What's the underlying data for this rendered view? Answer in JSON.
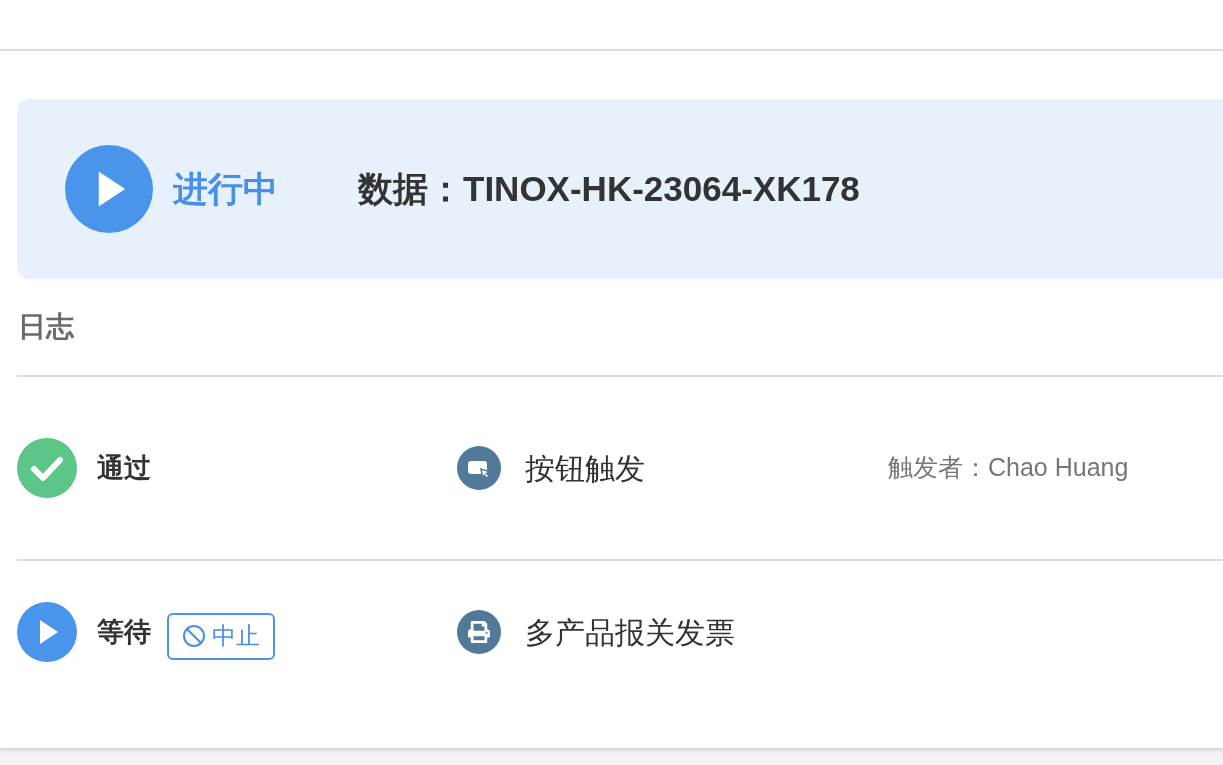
{
  "status_banner": {
    "kind": "running",
    "status": "进行中",
    "data": "数据：TINOX-HK-23064-XK178"
  },
  "log": {
    "title": "日志",
    "entries": [
      {
        "kind": "passed",
        "status": "通过",
        "action": {
          "kind": "button_trigger",
          "label": "按钮触发"
        },
        "triggered_by": "触发者：Chao Huang"
      },
      {
        "kind": "waiting",
        "status": "等待",
        "abort_button": "中止",
        "action": {
          "kind": "print",
          "label": "多产品报关发票"
        }
      }
    ]
  }
}
